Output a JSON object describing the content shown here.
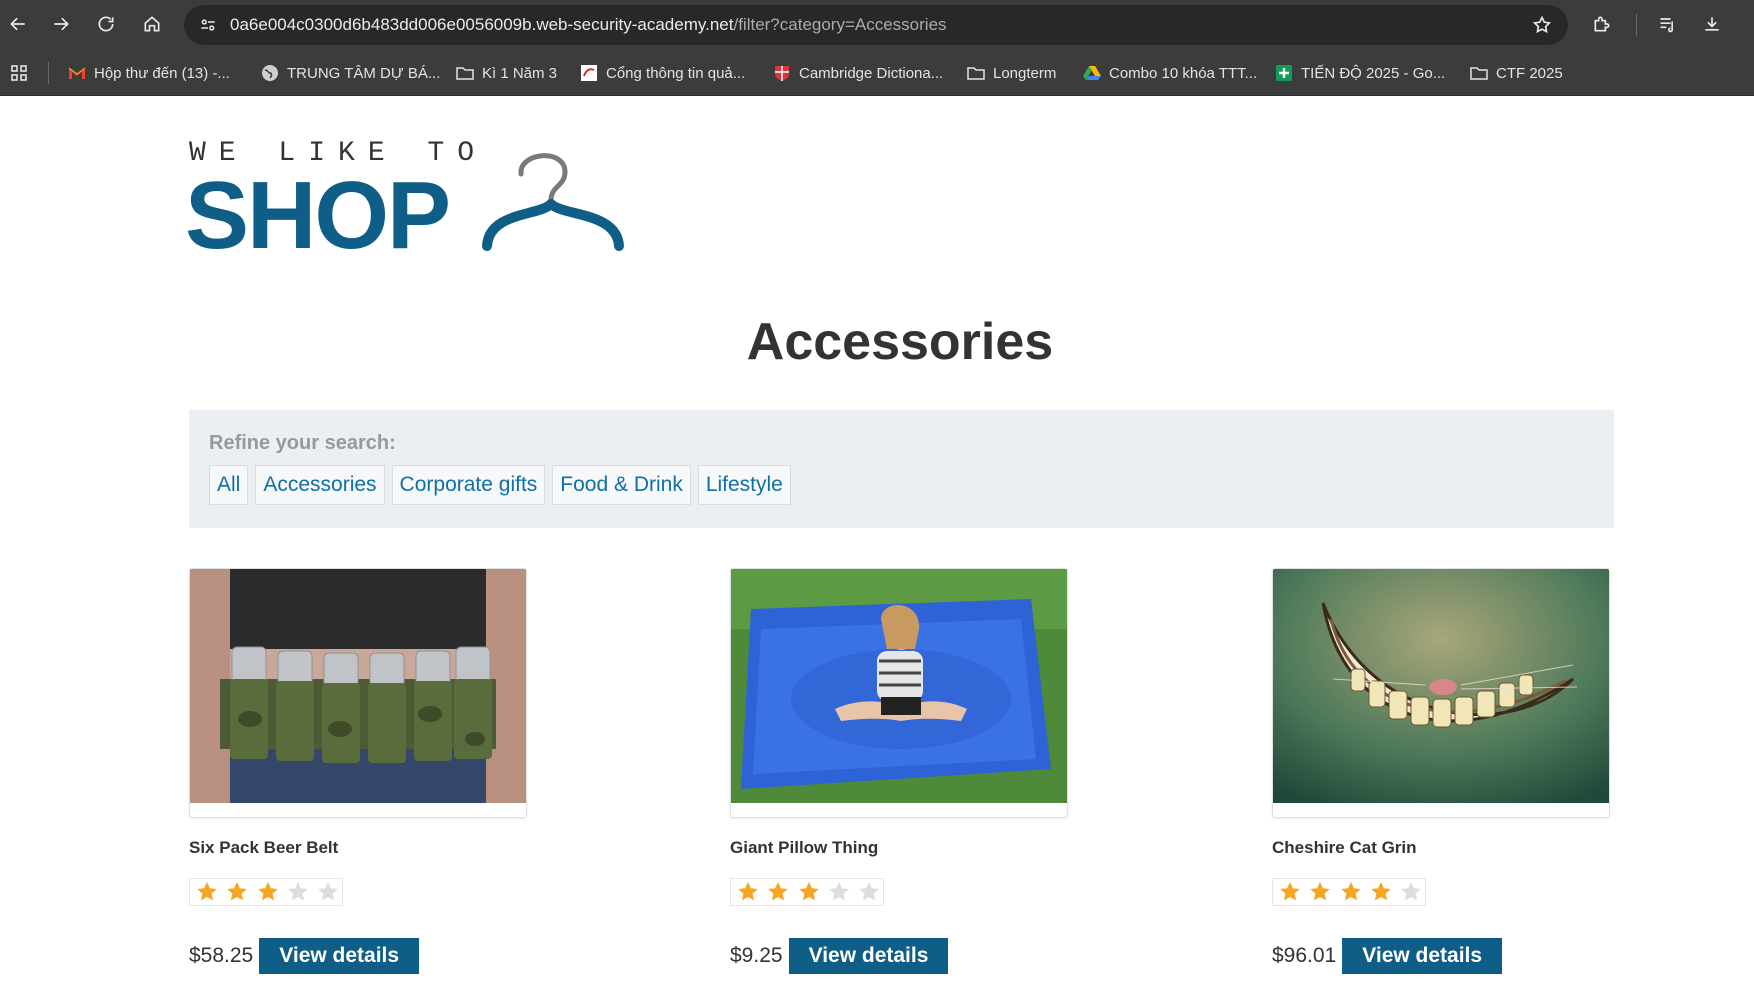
{
  "browser": {
    "url_host": "0a6e004c0300d6b483dd006e0056009b.web-security-academy.net",
    "url_path": "/filter?category=Accessories"
  },
  "bookmarks": [
    {
      "label": "Hộp thư đến (13) -...",
      "icon": "gmail-icon"
    },
    {
      "label": "TRUNG TÂM DỰ BÁ...",
      "icon": "globe-icon"
    },
    {
      "label": "Kì 1 Năm 3",
      "icon": "folder-icon"
    },
    {
      "label": "Cổng thông tin quả...",
      "icon": "portal-icon"
    },
    {
      "label": "Cambridge Dictiona...",
      "icon": "cambridge-icon"
    },
    {
      "label": "Longterm",
      "icon": "folder-icon"
    },
    {
      "label": "Combo 10 khóa TTT...",
      "icon": "drive-icon"
    },
    {
      "label": "TIẾN ĐỘ 2025 - Go...",
      "icon": "sheets-icon"
    },
    {
      "label": "CTF 2025",
      "icon": "folder-icon"
    }
  ],
  "logo": {
    "top_text": "WE LIKE TO",
    "main_text": "SHOP",
    "color": "#0f5e87"
  },
  "page": {
    "title": "Accessories"
  },
  "filter": {
    "label": "Refine your search:",
    "categories": [
      "All",
      "Accessories",
      "Corporate gifts",
      "Food & Drink",
      "Lifestyle"
    ]
  },
  "products": [
    {
      "name": "Six Pack Beer Belt",
      "rating": 3,
      "rating_max": 5,
      "price": "$58.25",
      "button": "View details"
    },
    {
      "name": "Giant Pillow Thing",
      "rating": 3,
      "rating_max": 5,
      "price": "$9.25",
      "button": "View details"
    },
    {
      "name": "Cheshire Cat Grin",
      "rating": 4,
      "rating_max": 5,
      "price": "$96.01",
      "button": "View details"
    }
  ],
  "colors": {
    "star_filled": "#f5a623",
    "star_empty": "#dddddd",
    "button_bg": "#0f5e87",
    "link": "#0f70a8"
  }
}
